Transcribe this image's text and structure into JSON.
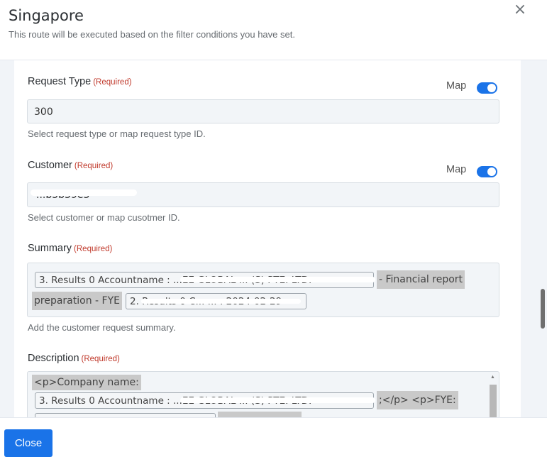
{
  "header": {
    "title": "Singapore",
    "subtitle": "This route will be executed based on the filter conditions you have set.",
    "close_icon": "×"
  },
  "fields": {
    "request_type": {
      "label": "Request Type",
      "required": "(Required)",
      "map_label": "Map",
      "value": "300",
      "hint": "Select request type or map request type ID."
    },
    "customer": {
      "label": "Customer",
      "required": "(Required)",
      "map_label": "Map",
      "value": "...b5b39e3",
      "hint": "Select customer or map cusotmer ID."
    },
    "summary": {
      "label": "Summary",
      "required": "(Required)",
      "chip1": "3. Results 0 Accountname : ...EE GLOBAL ... (S) PTE. LTD.",
      "text1": "- Financial report",
      "text2": "preparation - FYE",
      "chip2": "2. Results 0 C... ... : 2024-02-29",
      "hint": "Add the customer request summary."
    },
    "description": {
      "label": "Description",
      "required": "(Required)",
      "text1": "<p>Company name:",
      "chip1": "3. Results 0 Accountname : ...EE GLOBAL ... (S) PTE. LTD.",
      "text2": ";</p> <p>FYE:"
    }
  },
  "footer": {
    "close_label": "Close"
  },
  "colors": {
    "accent": "#1a73e8",
    "required": "#c0392b"
  }
}
